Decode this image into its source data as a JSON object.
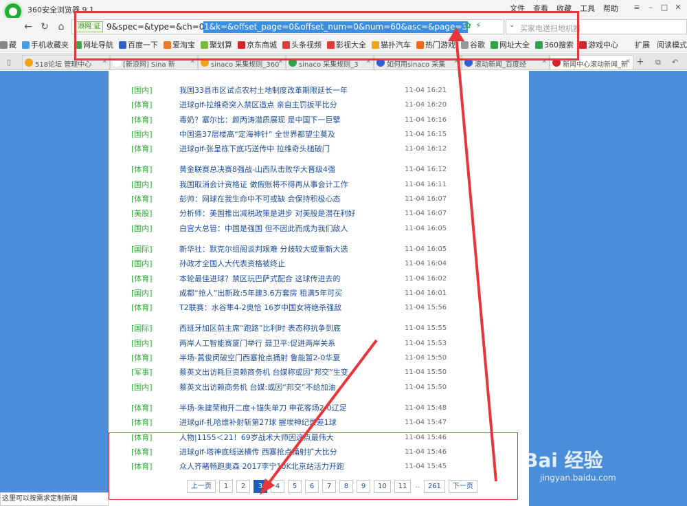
{
  "browser": {
    "title": "360安全浏览器 9.1",
    "menu": [
      "文件",
      "查看",
      "收藏",
      "工具",
      "帮助"
    ],
    "url_prefix": "9&spec=&type=&ch=0",
    "url_selected": "1&k=&offset_page=0&offset_num=0&num=60&asc=&page=3",
    "site_badge": "浪网 证",
    "search_placeholder": "买家电送扫地机器",
    "bookmarks": [
      {
        "label": "藏",
        "color": "#888888"
      },
      {
        "label": "手机收藏夹",
        "color": "#4a9be0"
      },
      {
        "label": "网址导航",
        "color": "#3fa64a"
      },
      {
        "label": "百度一下",
        "color": "#2e5fd6"
      },
      {
        "label": "爱淘宝",
        "color": "#f07a2a"
      },
      {
        "label": "聚划算",
        "color": "#7cb83a"
      },
      {
        "label": "京东商城",
        "color": "#d3232c"
      },
      {
        "label": "头条视频",
        "color": "#e03a3a"
      },
      {
        "label": "影视大全",
        "color": "#e03a3a"
      },
      {
        "label": "猫扑汽车",
        "color": "#f2a31a"
      },
      {
        "label": "热门游戏",
        "color": "#f26a1a"
      },
      {
        "label": "谷歌",
        "color": "#999999"
      },
      {
        "label": "网址大全",
        "color": "#2fa34b"
      },
      {
        "label": "360搜索",
        "color": "#2fa34b"
      },
      {
        "label": "游戏中心",
        "color": "#d3232c"
      }
    ],
    "bookmarks_right": [
      "扩展",
      "阅读模式"
    ],
    "tabs": [
      {
        "label": "518论坛 管理中心",
        "color": "#f2a31a"
      },
      {
        "label": "[新浪网] Sina 新",
        "color": "#ffffff"
      },
      {
        "label": "sinaco 采集规则_360",
        "color": "#f2a31a"
      },
      {
        "label": "sinaco 采集规则_3",
        "color": "#2fa34b"
      },
      {
        "label": "如何用sinaco 采集",
        "color": "#2e5fd6"
      },
      {
        "label": "滚动新闻_百度经",
        "color": "#2e5fd6"
      },
      {
        "label": "新闻中心滚动新闻_新",
        "color": "#d3232c"
      }
    ]
  },
  "news": [
    {
      "cat": "[国内]",
      "title": "我国33县市区试点农村土地制度改革期限延长一年",
      "time": "11-04 16:21"
    },
    {
      "cat": "[体育]",
      "title": "进球gif-拉维奇突入禁区造点 亲自主罚扳平比分",
      "time": "11-04 16:20"
    },
    {
      "cat": "[体育]",
      "title": "毒奶？塞尔比：颜丙涛潜质展现 是中国下一巨擘",
      "time": "11-04 16:16"
    },
    {
      "cat": "[国内]",
      "title": "中国造37层楼高“定海神针” 全世界都望尘莫及",
      "time": "11-04 16:15"
    },
    {
      "cat": "[体育]",
      "title": "进球gif-张呈栋下底巧送传中 拉维奇头槌破门",
      "time": "11-04 16:12"
    },
    {
      "cat": "[体育]",
      "title": "黄金联赛总决赛8强战-山西队击败华大晋级4强",
      "time": "11-04 16:12"
    },
    {
      "cat": "[国内]",
      "title": "我国取消会计资格证 做假账将不得再从事会计工作",
      "time": "11-04 16:11"
    },
    {
      "cat": "[体育]",
      "title": "彭帅：网球在我生命中不可或缺 会保持积极心态",
      "time": "11-04 16:07"
    },
    {
      "cat": "[美股]",
      "title": "分析师：美国推出减税政策是进步 对美股是潜在利好",
      "time": "11-04 16:07"
    },
    {
      "cat": "[国内]",
      "title": "白宫大总管：中国是强国 但不因此而成为我们敌人",
      "time": "11-04 16:05"
    },
    {
      "cat": "[国际]",
      "title": "新华社：默克尔组阁谈判艰难 分歧较大或重新大选",
      "time": "11-04 16:05"
    },
    {
      "cat": "[国内]",
      "title": "孙政才全国人大代表资格被终止",
      "time": "11-04 16:04"
    },
    {
      "cat": "[体育]",
      "title": "本轮最佳进球？禁区玩巴萨式配合 这球传进去的",
      "time": "11-04 16:02"
    },
    {
      "cat": "[国内]",
      "title": "成都“抢人”出新政:5年建3.6万套房 租满5年可买",
      "time": "11-04 16:01"
    },
    {
      "cat": "[体育]",
      "title": "T2联赛：水谷隼4-2奥恰 16岁中国女将绝杀强敌",
      "time": "11-04 15:56"
    },
    {
      "cat": "[国际]",
      "title": "西班牙加区前主席“跑路”比利时 表态称抗争到底",
      "time": "11-04 15:55"
    },
    {
      "cat": "[国内]",
      "title": "两岸人工智能赛厦门举行 聂卫平:促进两岸关系",
      "time": "11-04 15:53"
    },
    {
      "cat": "[体育]",
      "title": "半场-蒿俊闵破空门西塞抢点捅射 鲁能暂2-0华夏",
      "time": "11-04 15:50"
    },
    {
      "cat": "[军事]",
      "title": "蔡英文出访耗巨资赖商务机 台媒称或因“邦交”生变",
      "time": "11-04 15:50"
    },
    {
      "cat": "[国内]",
      "title": "蔡英文出访赖商务机 台媒:或因“邦交”不给加油",
      "time": "11-04 15:50"
    },
    {
      "cat": "[体育]",
      "title": "半场-朱建荣梅开二度+锚失单刀 申花客场2-0辽足",
      "time": "11-04 15:48"
    },
    {
      "cat": "[体育]",
      "title": "进球gif-扎哈维补射斩第27球 握埃神纪录差1球",
      "time": "11-04 15:47"
    },
    {
      "cat": "[体育]",
      "title": "人物|1155＜21！69岁战术大师因这点最伟大",
      "time": "11-04 15:46"
    },
    {
      "cat": "[体育]",
      "title": "进球gif-塔神底线送横传 西塞抢点捅射扩大比分",
      "time": "11-04 15:46"
    },
    {
      "cat": "[体育]",
      "title": "众人齐睹畅跑奥森 2017李宁10K北京站活力开跑",
      "time": "11-04 15:45"
    }
  ],
  "pager": {
    "prev": "上一页",
    "pages": [
      "1",
      "2",
      "3",
      "4",
      "5",
      "6",
      "7",
      "8",
      "9",
      "10",
      "11"
    ],
    "current": "3",
    "dots": "..",
    "last": "261",
    "next": "下一页"
  },
  "left_tip": "这里可以按需求定制新闻",
  "watermark": {
    "main": "Bai  经验",
    "sub": "jingyan.baidu.com"
  }
}
